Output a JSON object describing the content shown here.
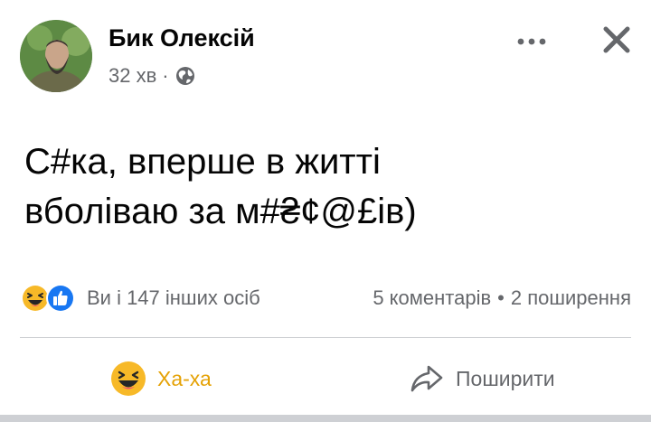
{
  "post": {
    "author": {
      "name": "Бик Олексій",
      "avatar": "avatar-photo"
    },
    "meta": {
      "time": "32 хв",
      "separator": "·",
      "privacy_icon": "globe-icon"
    },
    "header_actions": {
      "more_icon": "more-icon",
      "close_icon": "close-icon"
    },
    "text_lines": [
      "С#ка, вперше в житті",
      "вболіваю за м#₴¢@£ів)"
    ],
    "reactions": {
      "icons": [
        "haha-reaction-icon",
        "like-reaction-icon"
      ],
      "summary": "Ви і 147 інших осіб"
    },
    "counts": {
      "comments": "5 коментарів",
      "separator": "•",
      "shares": "2 поширення"
    },
    "actions": {
      "haha": {
        "label": "Ха-ха",
        "icon": "haha-emoji-icon",
        "color": "#e5a206"
      },
      "share": {
        "label": "Поширити",
        "icon": "share-arrow-icon"
      }
    }
  },
  "colors": {
    "text_primary": "#050505",
    "text_secondary": "#65676b",
    "like_blue": "#1877f2",
    "haha_yellow": "#f7b928",
    "divider": "#ced0d4"
  }
}
